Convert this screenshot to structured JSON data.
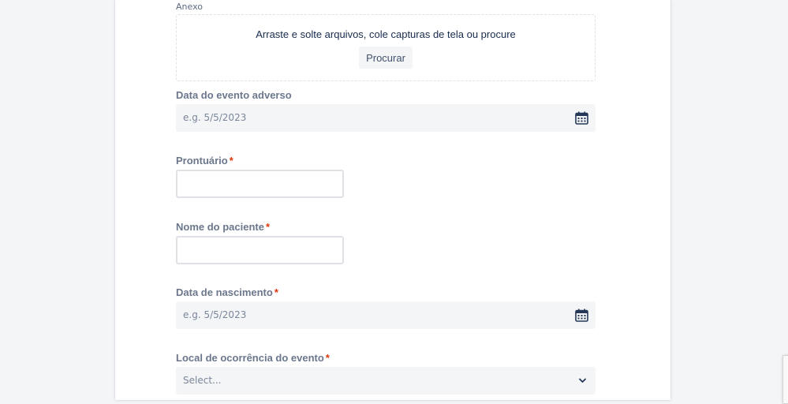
{
  "attachment": {
    "label": "Anexo",
    "dropzone_text": "Arraste e solte arquivos, cole capturas de tela ou procure",
    "browse_label": "Procurar"
  },
  "adverse_event_date": {
    "label": "Data do evento adverso",
    "placeholder": "e.g. 5/5/2023",
    "icon": "calendar-icon"
  },
  "medical_record": {
    "label": "Prontuário",
    "required_marker": "*",
    "value": ""
  },
  "patient_name": {
    "label": "Nome do paciente",
    "required_marker": "*",
    "value": ""
  },
  "birth_date": {
    "label": "Data de nascimento",
    "required_marker": "*",
    "placeholder": "e.g. 5/5/2023",
    "icon": "calendar-icon"
  },
  "event_location": {
    "label": "Local de ocorrência do evento",
    "required_marker": "*",
    "selected": "Select...",
    "icon": "chevron-down-icon"
  },
  "colors": {
    "label": "#6b778c",
    "required": "#de350b",
    "field_bg": "#f4f5f7",
    "text": "#172b4d"
  }
}
